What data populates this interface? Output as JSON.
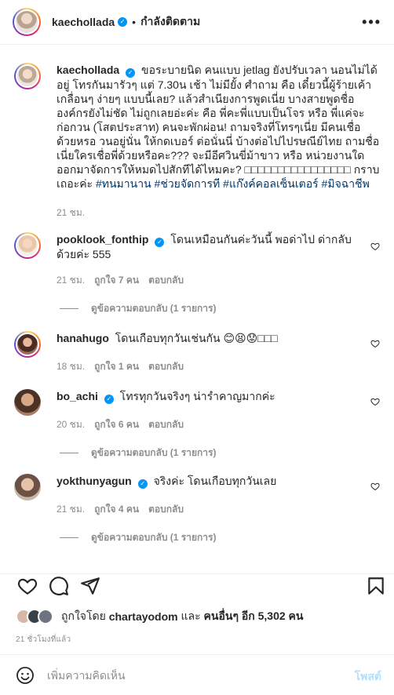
{
  "header": {
    "username": "kaechollada",
    "separator": "•",
    "follow_state": "กำลังติดตาม",
    "more": "•••"
  },
  "caption": {
    "username": "kaechollada",
    "text": "ขอระบายนิด คนแบบ jetlag ยังปรับเวลา นอนไม่ได้อยู่ โทรกันมารัวๆ แต่ 7.30น เช้า ไม่มียั้ง ศำถาม คือ เดี๋ยวนี้ผู้ร้ายเค้าเกลื่อนๆ ง่ายๆ แบบนี้เลย? แล้วสำเนียงการพูดเนี่ย บางสายพูดชื่อ องค์กรยังไม่ชัด ไม่ถูกเลยอ่ะค่ะ คือ พี่คะพี่แบบเป็นโจร หรือ พี่แค่จะก่อกวน (โสตประสาท) คนจะพักผ่อน! ถามจริงที่โทรๆเนี่ย มีคนเชื่อด้วยหรอ วนอยู่นั่น ให้กดเบอร์ ต่อนั่นนี่ บ้างต่อไปไปรษณีย์ไทย ถามชื่อเนี่ยใครเชื่อพี่ด้วยหรือคะ??? จะมีอีศวินขี่ม้าขาว หรือ หน่วยงานใดออกมาจัดการให้หมดไปสักทีได้ไหมคะ? □□□□□□□□□□□□□□□□ กราบเถอะค่ะ",
    "hashtags": "#ทนมานาน #ช่วยจัดการที #แก๊งค์คอลเซ็นเตอร์ #มิจฉาชีพ",
    "time": "21 ชม."
  },
  "comments": [
    {
      "username": "pooklook_fonthip",
      "verified": true,
      "text": "โดนเหมือนกันค่ะวันนี้ พอด่าไป ด่ากลับด้วยค่ะ 555",
      "time": "21 ชม.",
      "likes": "ถูกใจ 7 คน",
      "reply": "ตอบกลับ",
      "view_replies": "ดูข้อความตอบกลับ (1 รายการ)"
    },
    {
      "username": "hanahugo",
      "verified": false,
      "text": "โดนเกือบทุกวันเช่นกัน 😊😫😟□□□",
      "time": "18 ชม.",
      "likes": "ถูกใจ 1 คน",
      "reply": "ตอบกลับ",
      "view_replies": ""
    },
    {
      "username": "bo_achi",
      "verified": true,
      "text": "โทรทุกวันจริงๆ น่ารำคาญมากค่ะ",
      "time": "20 ชม.",
      "likes": "ถูกใจ 6 คน",
      "reply": "ตอบกลับ",
      "view_replies": "ดูข้อความตอบกลับ (1 รายการ)"
    },
    {
      "username": "yokthunyagun",
      "verified": true,
      "text": "จริงค่ะ โดนเกือบทุกวันเลย",
      "time": "21 ชม.",
      "likes": "ถูกใจ 4 คน",
      "reply": "ตอบกลับ",
      "view_replies": "ดูข้อความตอบกลับ (1 รายการ)"
    }
  ],
  "likes": {
    "prefix": "ถูกใจโดย",
    "user": "chartayodom",
    "middle": "และ",
    "others": "คนอื่นๆ อีก 5,302 คน"
  },
  "time_ago": "21 ชั่วโมงที่แล้ว",
  "add_comment": {
    "placeholder": "เพิ่มความคิดเห็น",
    "post_label": "โพสต์"
  },
  "icons": {
    "like": "heart-icon",
    "comment": "comment-icon",
    "share": "paper-plane-icon",
    "save": "bookmark-icon",
    "emoji": "smiley-icon",
    "comment_like": "small-heart-icon"
  },
  "colors": {
    "accent": "#0095f6",
    "post_disabled": "#b2dffc",
    "meta": "#8e8e8e"
  }
}
